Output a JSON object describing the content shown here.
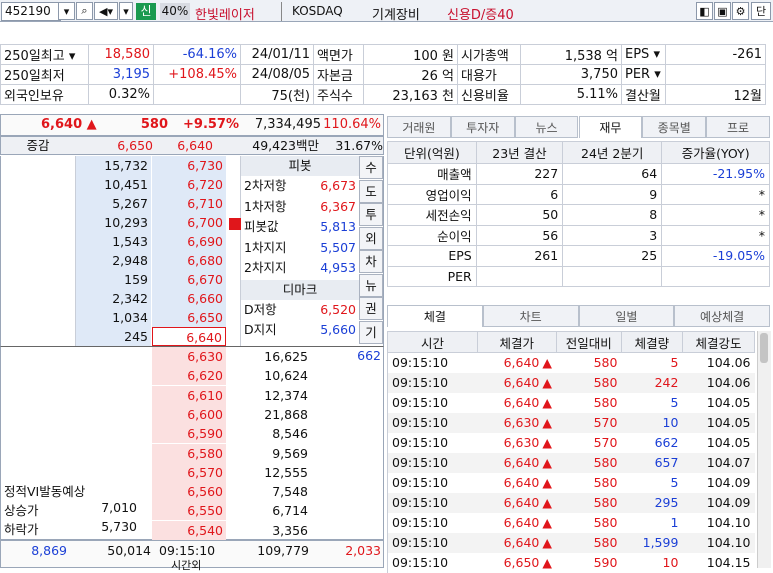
{
  "toolbar": {
    "code": "452190",
    "badge_sin": "신",
    "pct": "40%",
    "name": "한빛레이저",
    "market": "KOSDAQ",
    "sector": "기계장비",
    "credit": "신용D/증40",
    "btn_dan": "단"
  },
  "info": {
    "rows": [
      [
        "250일최고",
        "18,580",
        "-64.16%",
        "24/01/11",
        "액면가",
        "100 원",
        "시가총액",
        "1,538 억",
        "EPS",
        "-261"
      ],
      [
        "250일최저",
        "3,195",
        "+108.45%",
        "24/08/05",
        "자본금",
        "26 억",
        "대용가",
        "3,750",
        "PER",
        ""
      ],
      [
        "외국인보유",
        "0.32%",
        "",
        "75(천)",
        "주식수",
        "23,163 천",
        "신용비율",
        "5.11%",
        "결산월",
        "12월"
      ]
    ]
  },
  "price": {
    "current": "6,640",
    "arrow": "▲",
    "change": "580",
    "rate": "+9.57%",
    "volume": "7,334,495",
    "vol_ratio": "110.64%",
    "vol_ratio_pre": "▼",
    "amount": "49,423백만",
    "amt_rate": "31.67%"
  },
  "orderbook": {
    "header_left": "증감",
    "header_top_price": "6,650",
    "header_top_qty": "6,650",
    "header_price2": "6,640",
    "sell": [
      {
        "qty": "15,732",
        "price": "6,730"
      },
      {
        "qty": "10,451",
        "price": "6,720"
      },
      {
        "qty": "5,267",
        "price": "6,710"
      },
      {
        "qty": "10,293",
        "price": "6,700"
      },
      {
        "qty": "1,543",
        "price": "6,690"
      },
      {
        "qty": "2,948",
        "price": "6,680"
      },
      {
        "qty": "159",
        "price": "6,670"
      },
      {
        "qty": "2,342",
        "price": "6,660"
      },
      {
        "qty": "1,034",
        "price": "6,650"
      },
      {
        "qty": "245",
        "price": "6,640"
      }
    ],
    "buy": [
      {
        "price": "6,630",
        "qty": "16,625"
      },
      {
        "price": "6,620",
        "qty": "10,624"
      },
      {
        "price": "6,610",
        "qty": "12,374"
      },
      {
        "price": "6,600",
        "qty": "21,868"
      },
      {
        "price": "6,590",
        "qty": "8,546"
      },
      {
        "price": "6,580",
        "qty": "9,569"
      },
      {
        "price": "6,570",
        "qty": "12,555"
      },
      {
        "price": "6,560",
        "qty": "7,548"
      },
      {
        "price": "6,550",
        "qty": "6,714"
      },
      {
        "price": "6,540",
        "qty": "3,356"
      }
    ],
    "buy_first_extra": "662",
    "vi_label": "정적VI발동예상",
    "upper_label": "상승가",
    "upper_val": "7,010",
    "lower_label": "하락가",
    "lower_val": "5,730",
    "foot_left": "8,869",
    "foot_sell": "50,014",
    "foot_time": "09:15:10",
    "foot_buy": "109,779",
    "foot_right": "2,033",
    "foot_sub": "시간외"
  },
  "pivot": {
    "title": "피봇",
    "rows": [
      [
        "2차저항",
        "6,673"
      ],
      [
        "1차저항",
        "6,367"
      ],
      [
        "피봇값",
        "5,813"
      ],
      [
        "1차지지",
        "5,507"
      ],
      [
        "2차지지",
        "4,953"
      ]
    ],
    "demark_title": "디마크",
    "demark": [
      [
        "D저항",
        "6,520"
      ],
      [
        "D지지",
        "5,660"
      ]
    ],
    "side": [
      "수",
      "도",
      "투",
      "외",
      "차",
      "뉴",
      "권",
      "기"
    ]
  },
  "fin": {
    "tabs": [
      "거래원",
      "투자자",
      "뉴스",
      "재무",
      "종목별",
      "프로"
    ],
    "active": "재무",
    "headers": [
      "단위(억원)",
      "23년 결산",
      "24년 2분기",
      "증가율(YOY)"
    ],
    "rows": [
      [
        "매출액",
        "227",
        "64",
        "-21.95%"
      ],
      [
        "영업이익",
        "6",
        "9",
        "*"
      ],
      [
        "세전손익",
        "50",
        "8",
        "*"
      ],
      [
        "순이익",
        "56",
        "3",
        "*"
      ],
      [
        "EPS",
        "261",
        "25",
        "-19.05%"
      ],
      [
        "PER",
        "",
        "",
        ""
      ]
    ]
  },
  "trades": {
    "tabs": [
      "체결",
      "차트",
      "일별",
      "예상체결"
    ],
    "active": "체결",
    "headers": [
      "시간",
      "체결가",
      "전일대비",
      "체결량",
      "체결강도"
    ],
    "rows": [
      [
        "09:15:10",
        "6,640",
        "580",
        "5",
        "104.06",
        "red"
      ],
      [
        "09:15:10",
        "6,640",
        "580",
        "242",
        "104.06",
        "red"
      ],
      [
        "09:15:10",
        "6,640",
        "580",
        "5",
        "104.05",
        "blue"
      ],
      [
        "09:15:10",
        "6,630",
        "570",
        "10",
        "104.05",
        "blue"
      ],
      [
        "09:15:10",
        "6,630",
        "570",
        "662",
        "104.05",
        "blue"
      ],
      [
        "09:15:10",
        "6,640",
        "580",
        "657",
        "104.07",
        "blue"
      ],
      [
        "09:15:10",
        "6,640",
        "580",
        "5",
        "104.09",
        "blue"
      ],
      [
        "09:15:10",
        "6,640",
        "580",
        "295",
        "104.09",
        "blue"
      ],
      [
        "09:15:10",
        "6,640",
        "580",
        "1",
        "104.10",
        "blue"
      ],
      [
        "09:15:10",
        "6,640",
        "580",
        "1,599",
        "104.10",
        "blue"
      ],
      [
        "09:15:10",
        "6,650",
        "590",
        "10",
        "104.15",
        "red"
      ]
    ]
  }
}
